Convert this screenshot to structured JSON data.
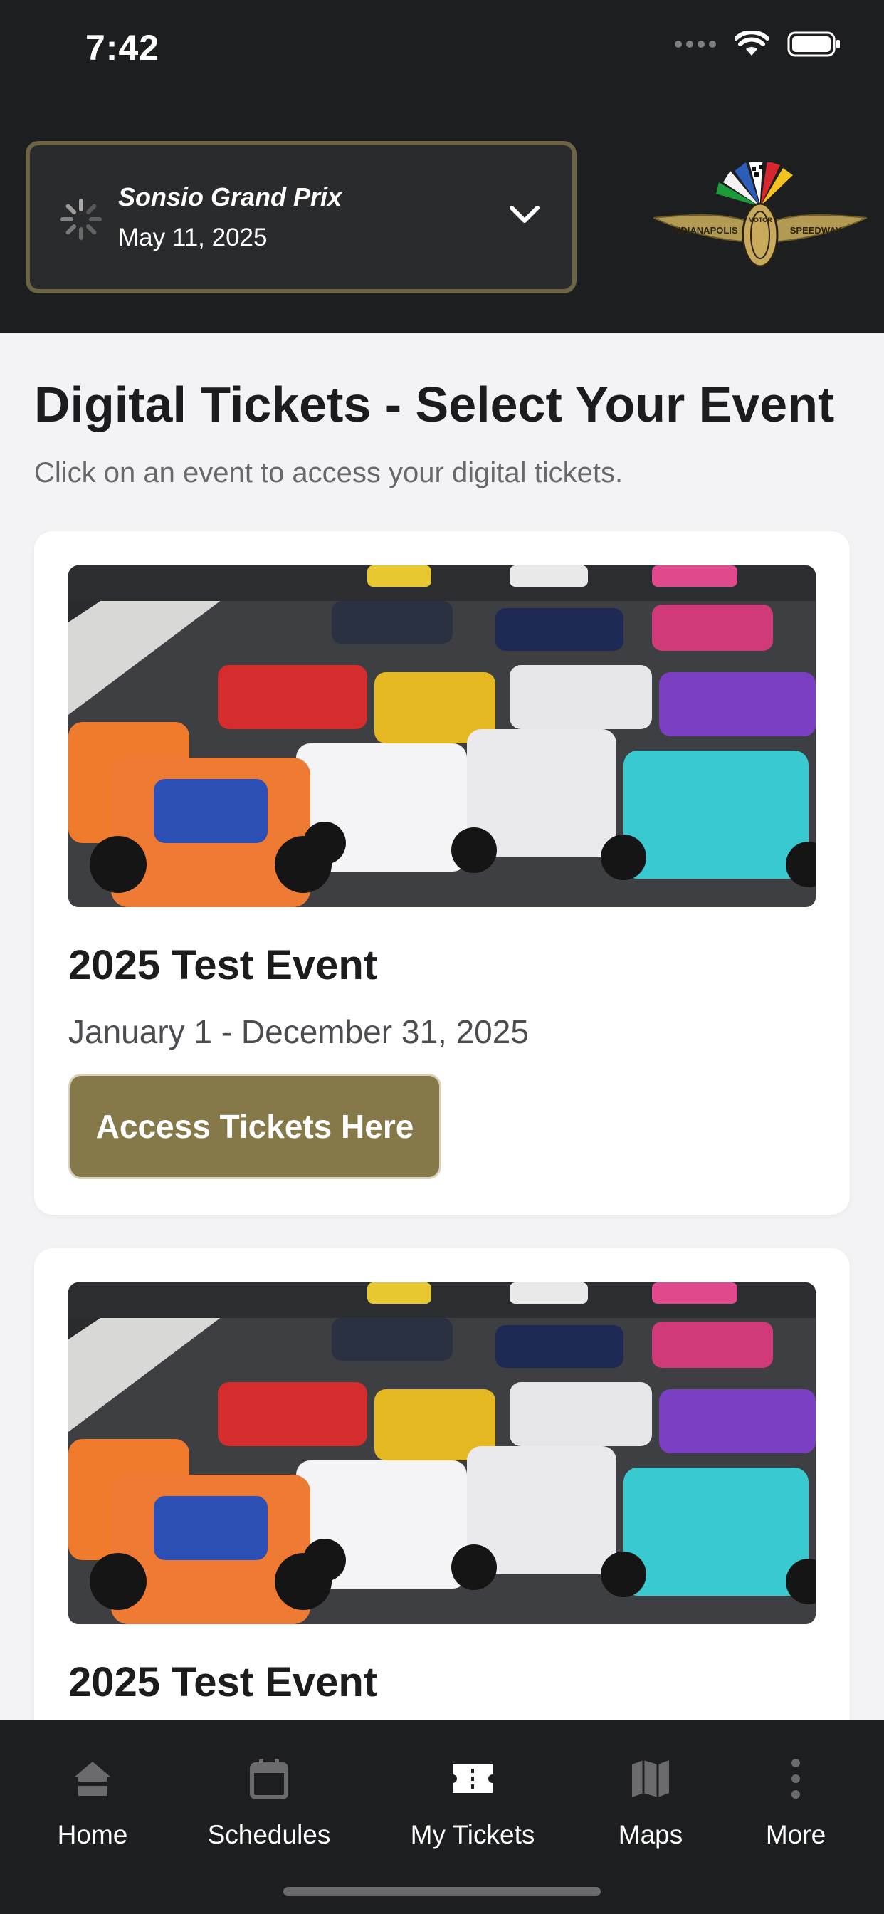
{
  "status_bar": {
    "time": "7:42"
  },
  "event_selector": {
    "name": "Sonsio Grand Prix",
    "date": "May 11, 2025"
  },
  "logo": {
    "text_left": "INDIANAPOLIS",
    "text_right": "SPEEDWAY",
    "text_center": "MOTOR"
  },
  "page": {
    "title": "Digital Tickets - Select Your Event",
    "subtitle": "Click on an event to access your digital tickets."
  },
  "events": [
    {
      "title": "2025 Test Event",
      "dates": "January 1 - December 31, 2025",
      "button_label": "Access Tickets Here"
    },
    {
      "title": "2025 Test Event"
    }
  ],
  "tab_bar": {
    "items": [
      {
        "label": "Home",
        "icon": "home-icon"
      },
      {
        "label": "Schedules",
        "icon": "calendar-icon"
      },
      {
        "label": "My Tickets",
        "icon": "ticket-icon"
      },
      {
        "label": "Maps",
        "icon": "map-icon"
      },
      {
        "label": "More",
        "icon": "more-vertical-icon"
      }
    ]
  },
  "colors": {
    "header_bg": "#1d1e20",
    "accent_gold": "#857849",
    "selector_border": "#6c6444",
    "page_bg": "#f3f3f5"
  }
}
